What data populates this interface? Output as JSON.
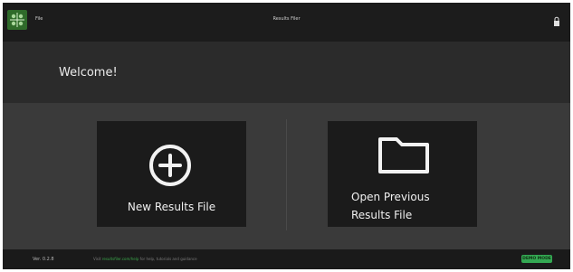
{
  "titlebar": {
    "menu_file": "File",
    "window_title": "Results Filer"
  },
  "welcome": {
    "heading": "Welcome!"
  },
  "cards": {
    "new_label": "New Results File",
    "open_label_line1": "Open Previous",
    "open_label_line2": "Results File"
  },
  "statusbar": {
    "version": "Ver. 0.2.8",
    "help_prefix": "Visit",
    "help_link": "resultsfiler.com/help",
    "help_suffix": "for help, tutorials and guidance",
    "badge": "DEMO MODE"
  },
  "colors": {
    "accent_green": "#34a853",
    "logo_green": "#2f6b2a"
  },
  "icons": {
    "logo": "app-logo-icon",
    "new": "plus-circle-icon",
    "open": "folder-icon",
    "titlebar_right": "lock-icon"
  }
}
